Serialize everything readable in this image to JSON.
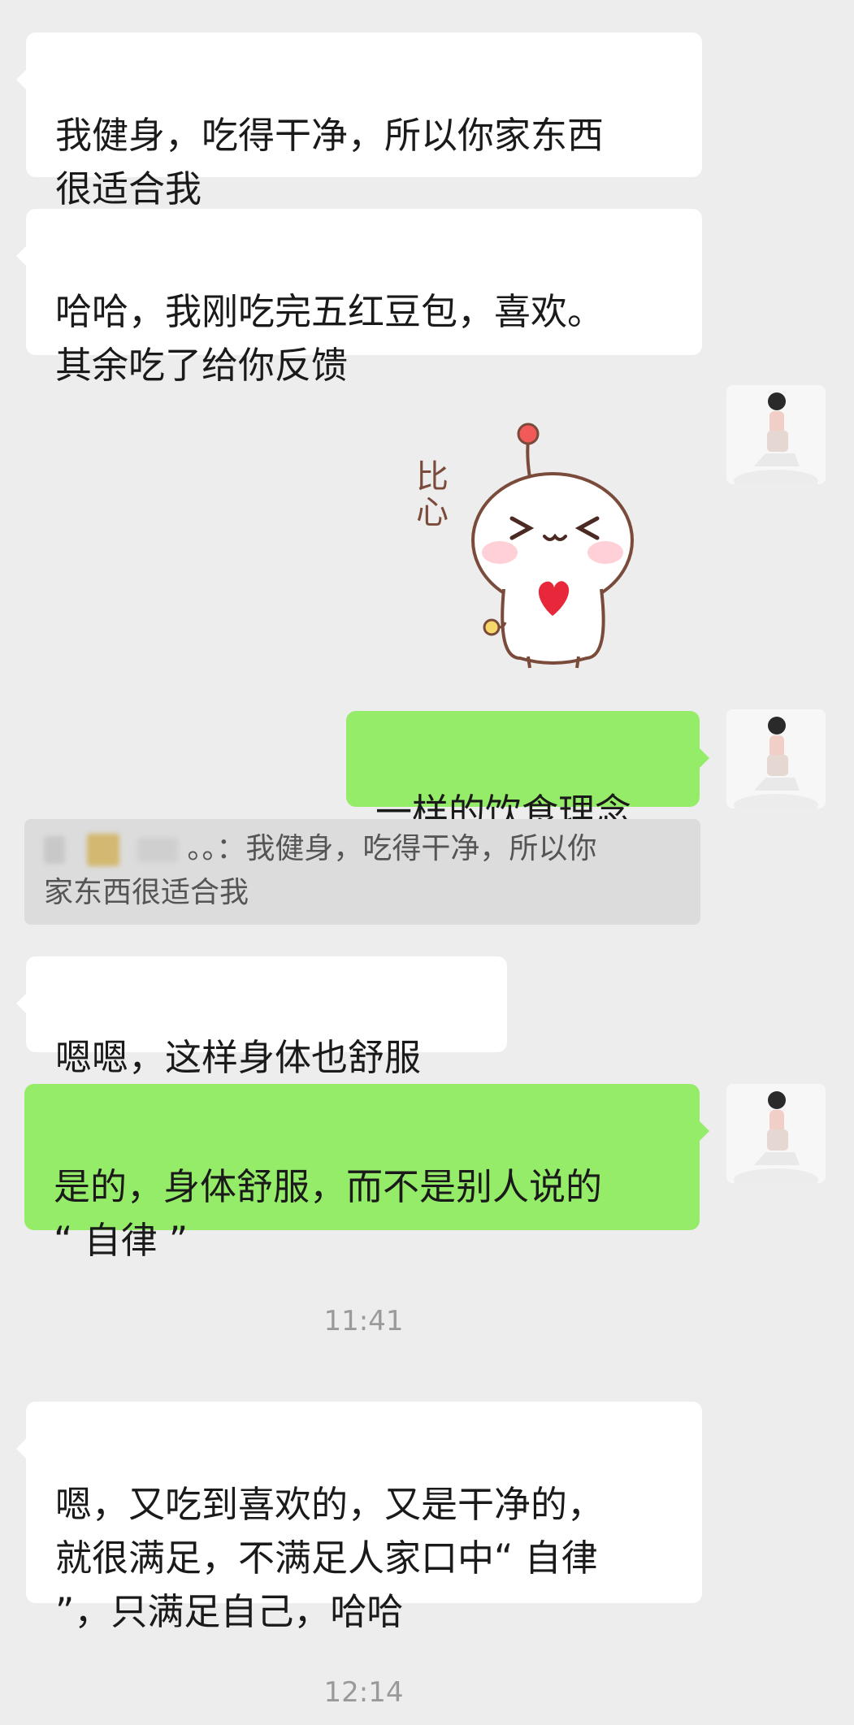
{
  "messages": [
    {
      "text": "我健身，吃得干净，所以你家东西\n很适合我"
    },
    {
      "text": "哈哈，我刚吃完五红豆包，喜欢。\n其余吃了给你反馈"
    },
    {
      "sticker_text": "比心"
    },
    {
      "text": "一样的饮食理念"
    },
    {
      "quote_suffix": "。。：我健身，吃得干净，所以你\n家东西很适合我"
    },
    {
      "text": "嗯嗯，这样身体也舒服"
    },
    {
      "text": "是的，身体舒服，而不是别人说的\n“ 自律 ”"
    },
    {
      "time": "11:41"
    },
    {
      "text": "嗯，又吃到喜欢的，又是干净的，\n就很满足，不满足人家口中“ 自律\n”，只满足自己，哈哈"
    },
    {
      "time": "12:14"
    }
  ],
  "colors": {
    "background": "#ededed",
    "incoming_bubble": "#ffffff",
    "outgoing_bubble": "#95ec69",
    "quote_bg": "#dcdcdc"
  },
  "icons": [
    "avatar-photo",
    "heart-sticker"
  ]
}
